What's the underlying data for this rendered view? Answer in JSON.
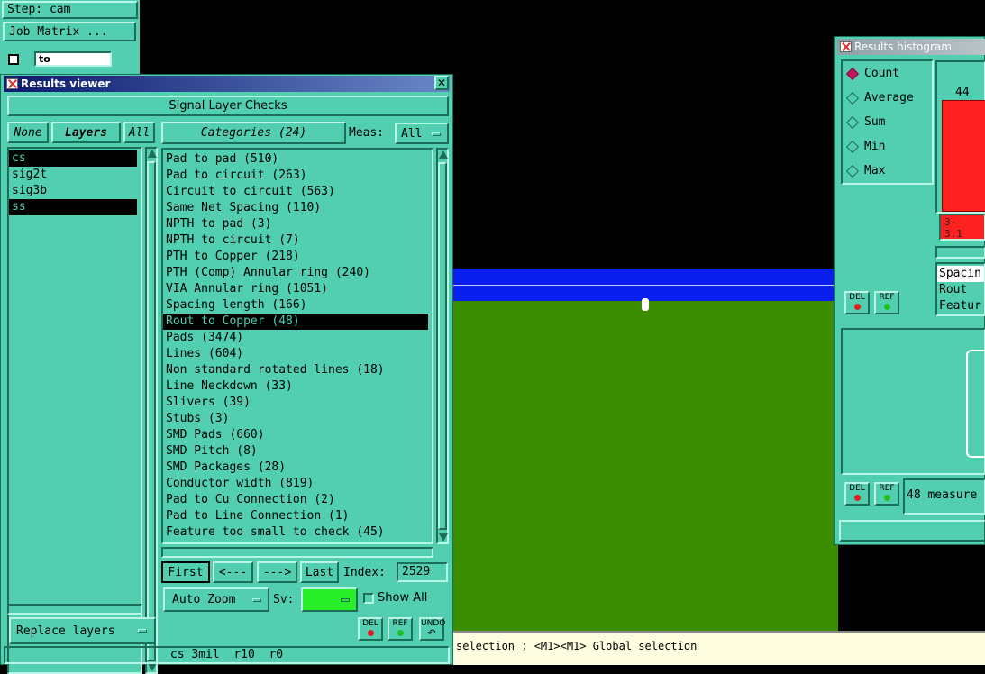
{
  "colors": {
    "panel": "#52cfb0",
    "canvas_bg": "#000000",
    "blue_band": "#0a1ef0",
    "green_field": "#3c8c00",
    "status_bg": "#fffde0"
  },
  "top_left": {
    "step_label": "Step: cam",
    "job_matrix_label": "Job Matrix ...",
    "to_field": "to"
  },
  "results_viewer": {
    "title": "Results viewer",
    "header": "Signal Layer Checks",
    "none_label": "None",
    "layers_label": "Layers",
    "all_label": "All",
    "layers": [
      "cs",
      "sig2t",
      "sig3b",
      "ss"
    ],
    "categories_label": "Categories (24)",
    "meas_label": "Meas:",
    "meas_value": "All",
    "categories": [
      "Pad to pad (510)",
      "Pad to circuit (263)",
      "Circuit to circuit (563)",
      "Same Net Spacing (110)",
      "NPTH to pad (3)",
      "NPTH to circuit (7)",
      "PTH to Copper (218)",
      "PTH (Comp) Annular ring (240)",
      "VIA Annular ring (1051)",
      "Spacing length (166)",
      "Rout to Copper (48)",
      "Pads (3474)",
      "Lines (604)",
      "Non standard rotated lines (18)",
      "Line Neckdown (33)",
      "Slivers (39)",
      "Stubs (3)",
      "SMD Pads (660)",
      "SMD Pitch (8)",
      "SMD Packages (28)",
      "Conductor width (819)",
      "Pad to Cu Connection (2)",
      "Pad to Line Connection (1)",
      "Feature too small to check (45)"
    ],
    "first_label": "First",
    "prev_label": "<---",
    "next_label": "--->",
    "last_label": "Last",
    "index_label": "Index:",
    "index_value": "2529",
    "auto_zoom_label": "Auto Zoom",
    "sv_label": "Sv:",
    "show_all_label": "Show All",
    "replace_layers_label": "Replace layers",
    "del_label": "DEL",
    "ref_label": "REF",
    "undo_label": "UNDO",
    "status_line": "cs 3mil  r10  r0"
  },
  "histogram": {
    "title": "Results histogram",
    "options": [
      "Count",
      "Average",
      "Sum",
      "Min",
      "Max"
    ],
    "bar_value": "44",
    "bar_label": "3-\n3.1",
    "list": [
      "Spacin",
      "Rout",
      "Featur"
    ],
    "measure_text": "48 measure",
    "del_label": "DEL",
    "ref_label": "REF"
  },
  "status_bar": {
    "text": "selection ; <M1><M1> Global selection"
  }
}
